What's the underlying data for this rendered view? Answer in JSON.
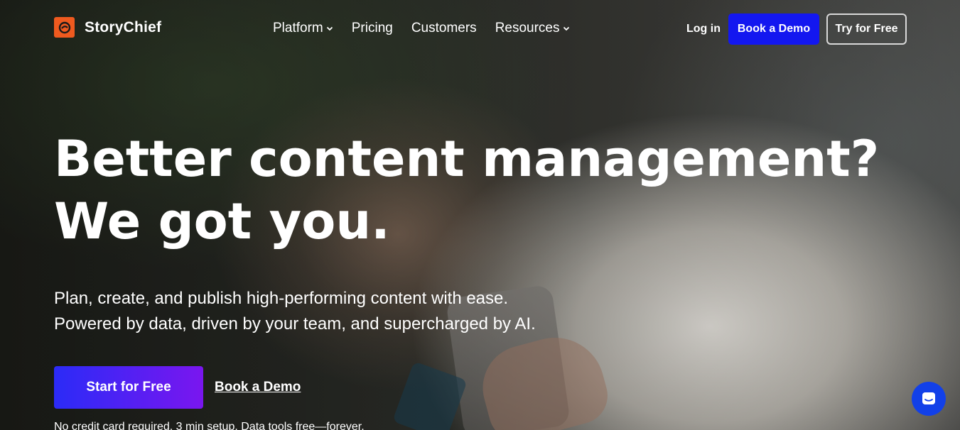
{
  "brand": {
    "name": "StoryChief",
    "logo_color": "#ef5a1f"
  },
  "nav": {
    "links": [
      {
        "label": "Platform",
        "has_dropdown": true
      },
      {
        "label": "Pricing",
        "has_dropdown": false
      },
      {
        "label": "Customers",
        "has_dropdown": false
      },
      {
        "label": "Resources",
        "has_dropdown": true
      }
    ],
    "login_label": "Log in",
    "demo_label": "Book a Demo",
    "try_label": "Try for Free"
  },
  "hero": {
    "headline_line1": "Better content management?",
    "headline_line2": "We got you.",
    "sub_line1": "Plan, create, and publish high-performing content with ease.",
    "sub_line2": "Powered by data, driven by your team, and supercharged by AI.",
    "start_label": "Start for Free",
    "demo_link_label": "Book a Demo",
    "fineprint": "No credit card required. 3 min setup. Data tools free—forever."
  },
  "colors": {
    "primary_blue": "#1317f0",
    "gradient_start": "#2b2bf7",
    "gradient_end": "#7a16ef",
    "chat_blue": "#1240e8"
  },
  "icons": {
    "chat": "chat-bubble-icon",
    "dropdown": "chevron-down-icon"
  }
}
